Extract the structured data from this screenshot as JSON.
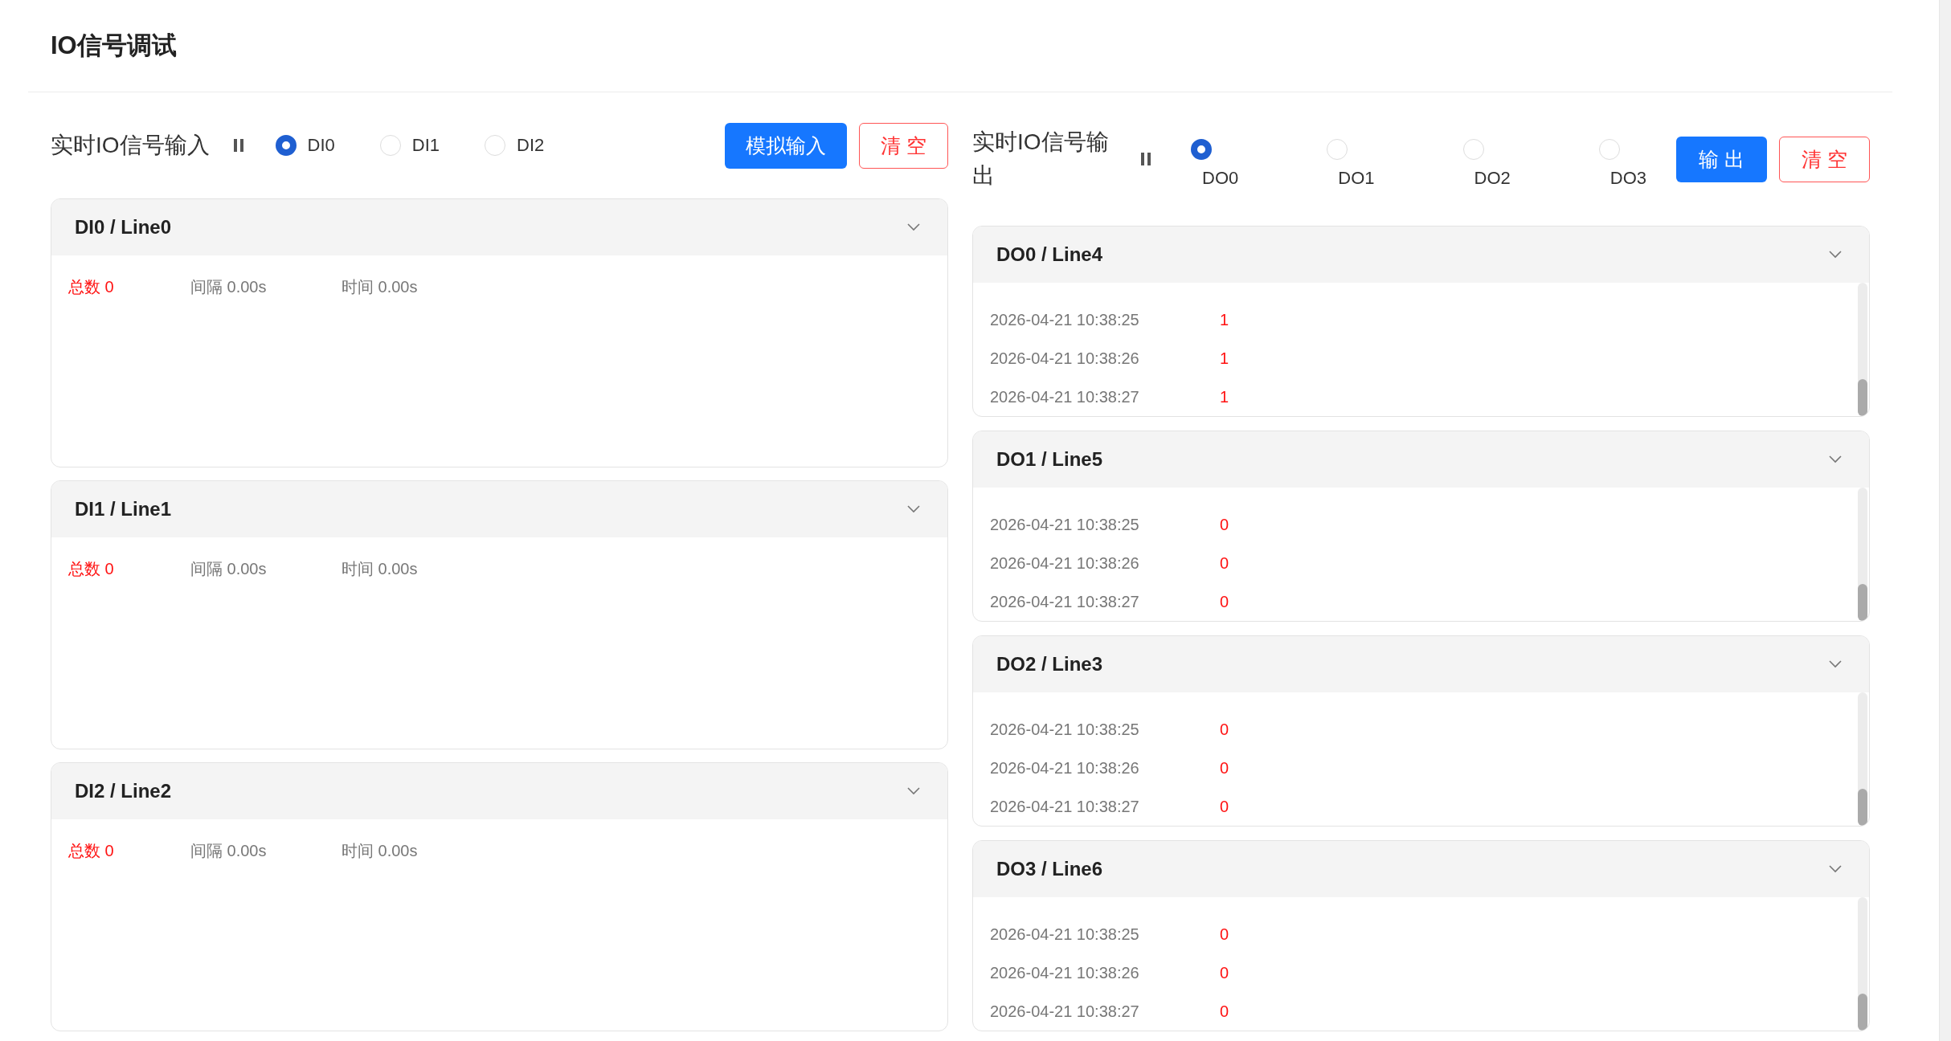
{
  "page": {
    "title": "IO信号调试"
  },
  "input": {
    "label": "实时IO信号输入",
    "channels": [
      {
        "label": "DI0",
        "selected": true
      },
      {
        "label": "DI1",
        "selected": false
      },
      {
        "label": "DI2",
        "selected": false
      }
    ],
    "buttons": [
      {
        "label": "模拟输入",
        "kind": "primary"
      },
      {
        "label": "清 空",
        "kind": "danger"
      }
    ],
    "panels": [
      {
        "title": "DI0 / Line0",
        "total": "总数 0",
        "interval": "间隔 0.00s",
        "time": "时间 0.00s"
      },
      {
        "title": "DI1 / Line1",
        "total": "总数 0",
        "interval": "间隔 0.00s",
        "time": "时间 0.00s"
      },
      {
        "title": "DI2 / Line2",
        "total": "总数 0",
        "interval": "间隔 0.00s",
        "time": "时间 0.00s"
      }
    ]
  },
  "output": {
    "label": "实时IO信号输出",
    "channels": [
      {
        "label": "DO0",
        "selected": true
      },
      {
        "label": "DO1",
        "selected": false
      },
      {
        "label": "DO2",
        "selected": false
      },
      {
        "label": "DO3",
        "selected": false
      }
    ],
    "buttons": [
      {
        "label": "输 出",
        "kind": "primary"
      },
      {
        "label": "清 空",
        "kind": "danger"
      }
    ],
    "panels": [
      {
        "title": "DO0 / Line4",
        "rows": [
          {
            "time": "2026-04-21 10:38:25",
            "value": "1"
          },
          {
            "time": "2026-04-21 10:38:26",
            "value": "1"
          },
          {
            "time": "2026-04-21 10:38:27",
            "value": "1"
          }
        ]
      },
      {
        "title": "DO1 / Line5",
        "rows": [
          {
            "time": "2026-04-21 10:38:25",
            "value": "0"
          },
          {
            "time": "2026-04-21 10:38:26",
            "value": "0"
          },
          {
            "time": "2026-04-21 10:38:27",
            "value": "0"
          }
        ]
      },
      {
        "title": "DO2 / Line3",
        "rows": [
          {
            "time": "2026-04-21 10:38:25",
            "value": "0"
          },
          {
            "time": "2026-04-21 10:38:26",
            "value": "0"
          },
          {
            "time": "2026-04-21 10:38:27",
            "value": "0"
          }
        ]
      },
      {
        "title": "DO3 / Line6",
        "rows": [
          {
            "time": "2026-04-21 10:38:25",
            "value": "0"
          },
          {
            "time": "2026-04-21 10:38:26",
            "value": "0"
          },
          {
            "time": "2026-04-21 10:38:27",
            "value": "0"
          }
        ]
      }
    ]
  }
}
